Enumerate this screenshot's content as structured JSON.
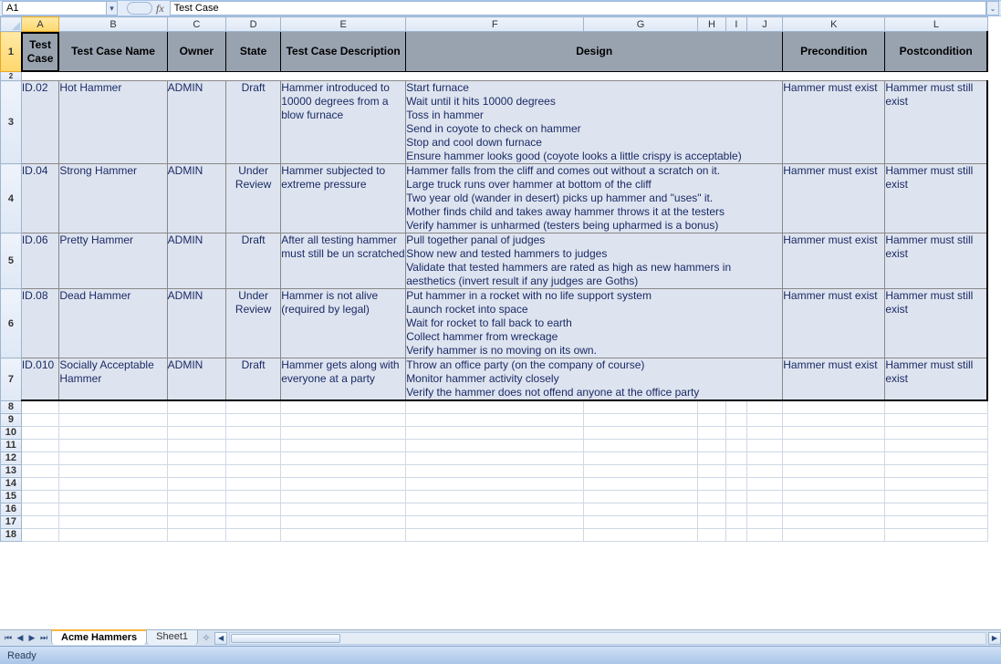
{
  "namebox": {
    "ref": "A1"
  },
  "formula_bar": {
    "fx_label": "fx",
    "value": "Test Case"
  },
  "column_letters": [
    "A",
    "B",
    "C",
    "D",
    "E",
    "F",
    "G",
    "H",
    "I",
    "J",
    "K",
    "L"
  ],
  "headers": {
    "test_case": "Test Case",
    "name": "Test Case Name",
    "owner": "Owner",
    "state": "State",
    "description": "Test Case Description",
    "design": "Design",
    "precondition": "Precondition",
    "postcondition": "Postcondition"
  },
  "rows": [
    {
      "rownum": "3",
      "id": "ID.02",
      "name": "Hot Hammer",
      "owner": "ADMIN",
      "state": "Draft",
      "desc": "Hammer introduced to 10000 degrees from a blow furnace",
      "design": "Start furnace\nWait until it hits 10000 degrees\nToss in hammer\nSend in coyote to check on hammer\nStop and cool down furnace\nEnsure hammer looks good (coyote looks a little crispy is acceptable)",
      "pre": "Hammer must exist",
      "post": "Hammer must still exist"
    },
    {
      "rownum": "4",
      "id": "ID.04",
      "name": "Strong Hammer",
      "owner": "ADMIN",
      "state": "Under Review",
      "desc": "Hammer subjected to extreme pressure",
      "design": "Hammer falls from the cliff and comes out without a scratch on it.\nLarge truck runs over hammer at bottom of the cliff\nTwo year old (wander in desert) picks up hammer and \"uses\" it.\nMother finds child and takes away hammer throws it at the testers\nVerify hammer is unharmed (testers being upharmed is a bonus)",
      "pre": "Hammer must exist",
      "post": "Hammer must still exist"
    },
    {
      "rownum": "5",
      "id": "ID.06",
      "name": "Pretty Hammer",
      "owner": "ADMIN",
      "state": "Draft",
      "desc": "After all testing hammer must still be un scratched",
      "design": "Pull together panal of judges\nShow new and tested hammers to judges\nValidate that tested hammers are rated as high as new hammers in aesthetics (invert result if any judges are Goths)",
      "pre": "Hammer must exist",
      "post": "Hammer must still exist"
    },
    {
      "rownum": "6",
      "id": "ID.08",
      "name": "Dead Hammer",
      "owner": "ADMIN",
      "state": "Under Review",
      "desc": "Hammer is not alive (required by legal)",
      "design": "Put hammer in a rocket with no life support system\nLaunch rocket into space\nWait for rocket to fall back to earth\nCollect hammer from wreckage\nVerify hammer is no moving on its own.",
      "pre": "Hammer must exist",
      "post": "Hammer must still exist"
    },
    {
      "rownum": "7",
      "id": "ID.010",
      "name": "Socially Acceptable Hammer",
      "owner": "ADMIN",
      "state": "Draft",
      "desc": "Hammer gets along with everyone at a party",
      "design": "Throw an office party (on the company of course)\nMonitor hammer activity closely\nVerify the hammer does not offend anyone at the office party",
      "pre": "Hammer must exist",
      "post": "Hammer must still exist"
    }
  ],
  "empty_rows": [
    "8",
    "9",
    "10",
    "11",
    "12",
    "13",
    "14",
    "15",
    "16",
    "17",
    "18"
  ],
  "tabs": {
    "active": "Acme Hammers",
    "others": [
      "Sheet1"
    ]
  },
  "status": {
    "text": "Ready"
  }
}
